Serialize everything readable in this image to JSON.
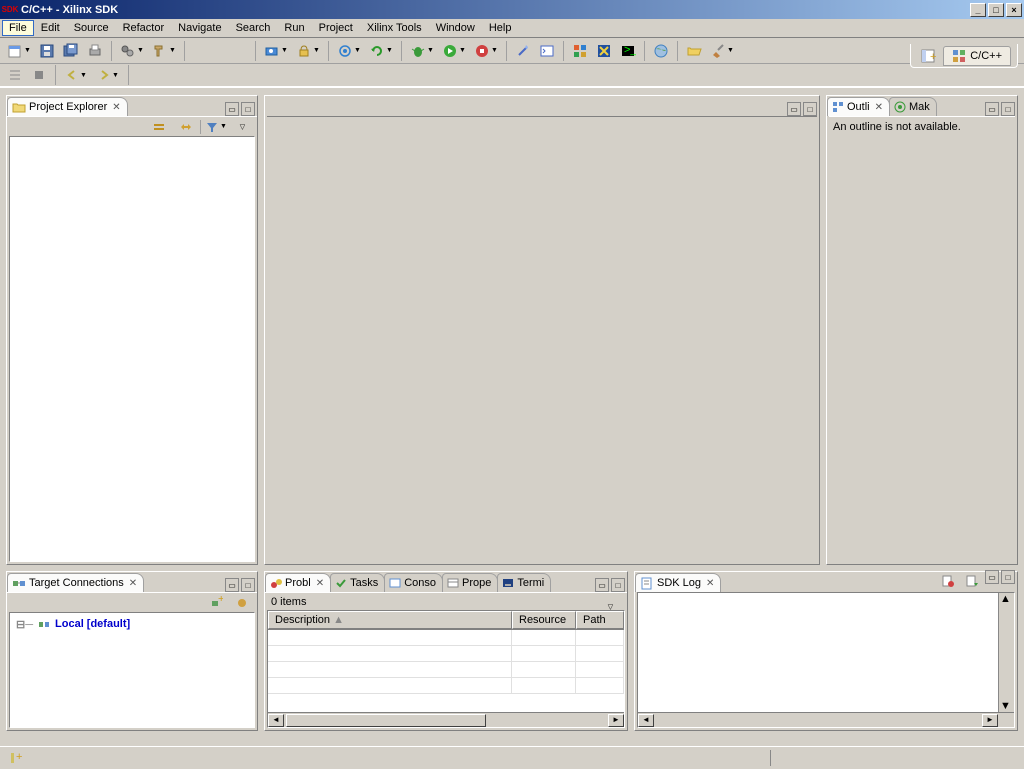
{
  "window": {
    "sdk_badge": "SDK",
    "title": "C/C++ - Xilinx SDK",
    "min": "_",
    "max": "□",
    "close": "×"
  },
  "menu": [
    "File",
    "Edit",
    "Source",
    "Refactor",
    "Navigate",
    "Search",
    "Run",
    "Project",
    "Xilinx Tools",
    "Window",
    "Help"
  ],
  "perspective": {
    "label": "C/C++"
  },
  "project_explorer": {
    "title": "Project Explorer"
  },
  "target_conn": {
    "title": "Target Connections",
    "item": "Local [default]"
  },
  "outline": {
    "tab1": "Outli",
    "tab2": "Mak",
    "message": "An outline is not available."
  },
  "problems": {
    "tabs": [
      "Probl",
      "Tasks",
      "Conso",
      "Prope",
      "Termi"
    ],
    "items_label": "0 items",
    "columns": {
      "description": "Description",
      "resource": "Resource",
      "path": "Path"
    }
  },
  "sdklog": {
    "title": "SDK Log"
  }
}
